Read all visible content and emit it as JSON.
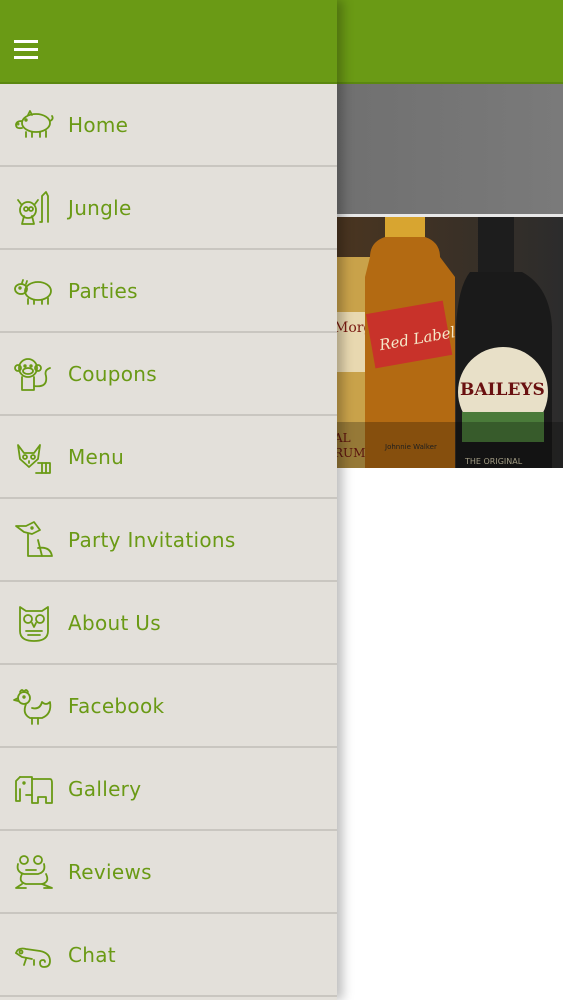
{
  "colors": {
    "brand_green": "#6a9a15",
    "drawer_bg": "#e3e0da"
  },
  "header": {
    "menu_icon": "hamburger-icon"
  },
  "banner": {
    "bottle_labels": [
      "Morgan",
      "Red Label",
      "BAILEYS"
    ],
    "label_fragments": [
      "AL",
      "RUM"
    ],
    "small_prints": [
      "Johnnie Walker",
      "THE ORIGINAL"
    ]
  },
  "drawer": {
    "items": [
      {
        "label": "Home",
        "icon": "pig-icon"
      },
      {
        "label": "Jungle",
        "icon": "lemur-icon"
      },
      {
        "label": "Parties",
        "icon": "hippo-icon"
      },
      {
        "label": "Coupons",
        "icon": "monkey-icon"
      },
      {
        "label": "Menu",
        "icon": "raccoon-icon"
      },
      {
        "label": "Party Invitations",
        "icon": "fox-icon"
      },
      {
        "label": "About Us",
        "icon": "owl-icon"
      },
      {
        "label": "Facebook",
        "icon": "rooster-icon"
      },
      {
        "label": "Gallery",
        "icon": "elephant-icon"
      },
      {
        "label": "Reviews",
        "icon": "frog-icon"
      },
      {
        "label": "Chat",
        "icon": "chameleon-icon"
      }
    ]
  }
}
